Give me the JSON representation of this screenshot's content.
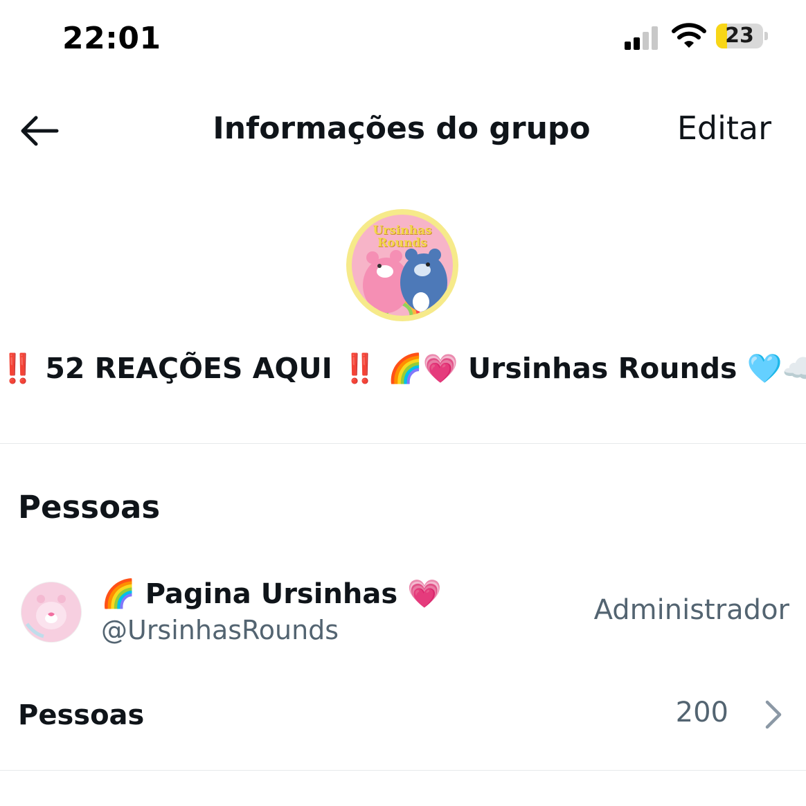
{
  "status_bar": {
    "time": "22:01",
    "battery": "23",
    "battery_level": 0.23,
    "signal_bars_active": 2,
    "signal_bars_total": 4
  },
  "nav": {
    "title": "Informações do grupo",
    "edit_label": "Editar",
    "back_icon": "arrow-left-icon"
  },
  "group": {
    "avatar_text_line1": "Ursinhas",
    "avatar_text_line2": "Rounds",
    "name_emoji_1": "‼️",
    "name_text": "52 REAÇÕES AQUI",
    "name_emoji_2": "‼️",
    "name_emoji_3": "🌈💗",
    "name_text_2": "Ursinhas Rounds",
    "name_emoji_4": "🩵☁️"
  },
  "people_section": {
    "title": "Pessoas",
    "member": {
      "name_emoji_prefix": "🌈",
      "name": "Pagina Ursinhas",
      "name_emoji_suffix": "💗",
      "handle": "@UrsinhasRounds",
      "role": "Administrador"
    },
    "count_row": {
      "label": "Pessoas",
      "count": "200",
      "chevron_icon": "chevron-right-icon"
    }
  },
  "colors": {
    "text_primary": "#0f1419",
    "text_secondary": "#536471",
    "divider": "#e6e9eb",
    "battery_fill": "#f8d617",
    "bang_red": "#e0241b"
  }
}
